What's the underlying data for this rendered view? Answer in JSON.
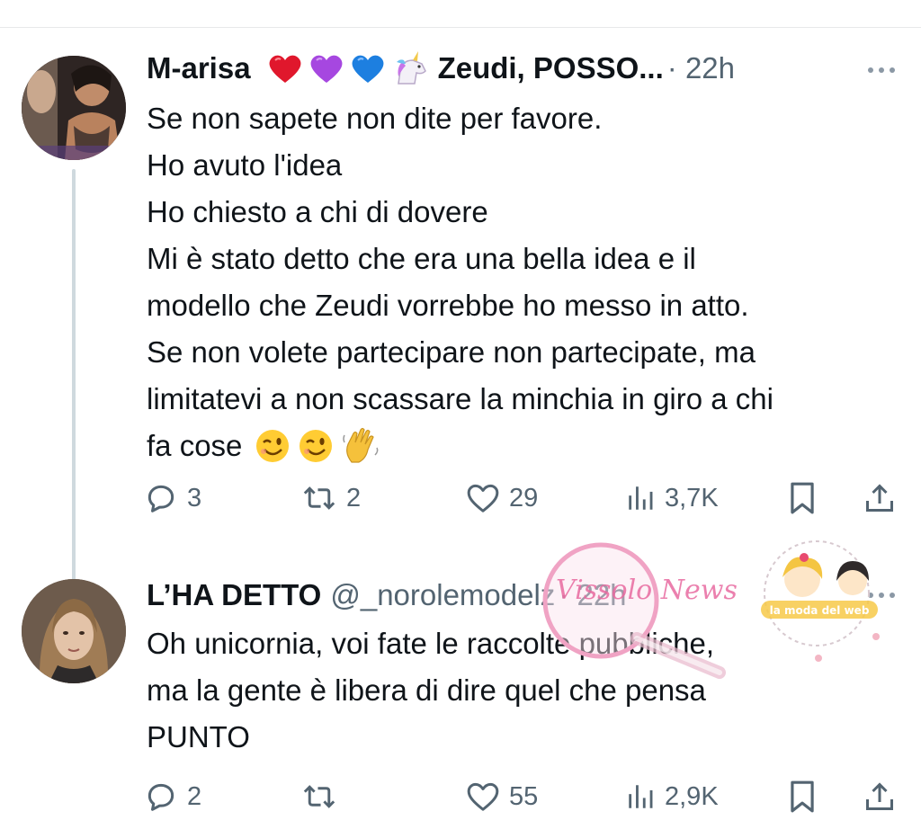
{
  "tweets": [
    {
      "display_name": "M-arisa",
      "display_name_emojis": [
        "heart-red",
        "heart-purple",
        "heart-blue",
        "unicorn"
      ],
      "display_name_suffix": "Zeudi, POSSO...",
      "time": "· 22h",
      "body_lines": [
        "Se non sapete non dite per favore.",
        "Ho avuto l'idea",
        "Ho chiesto a chi di dovere",
        "Mi è stato detto che era una bella idea e il",
        "modello che Zeudi vorrebbe ho messo in atto.",
        "Se non volete partecipare non partecipate, ma",
        "limitatevi a non scassare la minchia in giro a chi",
        "fa cose"
      ],
      "body_trailing_emojis": [
        "winking-face",
        "winking-face",
        "waving-hand"
      ],
      "stats": {
        "replies": "3",
        "retweets": "2",
        "likes": "29",
        "views": "3,7K"
      }
    },
    {
      "display_name": "L’HA DETTO",
      "handle": "@_norolemodelz",
      "time": "· 22h",
      "body_lines": [
        "Oh unicornia, voi fate le raccolte pubbliche,",
        "ma la gente è libera di dire quel che pensa",
        "PUNTO"
      ],
      "stats": {
        "replies": "2",
        "retweets": "",
        "likes": "55",
        "views": "2,9K"
      }
    }
  ],
  "watermarks": {
    "stamp_text": "Vissolo News",
    "badge_text": "la moda del web"
  },
  "colors": {
    "text": "#0f1419",
    "secondary": "#536471",
    "divider": "#e7e9ea",
    "thread": "#cfd9de"
  }
}
